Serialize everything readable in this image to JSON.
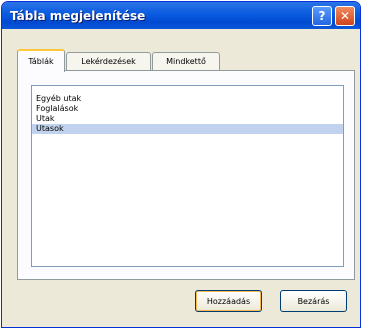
{
  "dialog": {
    "title": "Tábla megjelenítése",
    "help_label": "?",
    "close_label": "✕"
  },
  "tabs": [
    {
      "label": "Táblák",
      "active": true
    },
    {
      "label": "Lekérdezések",
      "active": false
    },
    {
      "label": "Mindkettő",
      "active": false
    }
  ],
  "list": {
    "items": [
      {
        "label": "Egyéb utak"
      },
      {
        "label": "Foglalások"
      },
      {
        "label": "Utak"
      },
      {
        "label": "Utasok",
        "selected": true
      }
    ]
  },
  "buttons": {
    "add": "Hozzáadás",
    "close": "Bezárás"
  },
  "colors": {
    "titlebar": "#0a5be0",
    "selection": "#c1d2ee",
    "dialog_bg": "#ece9d8"
  }
}
